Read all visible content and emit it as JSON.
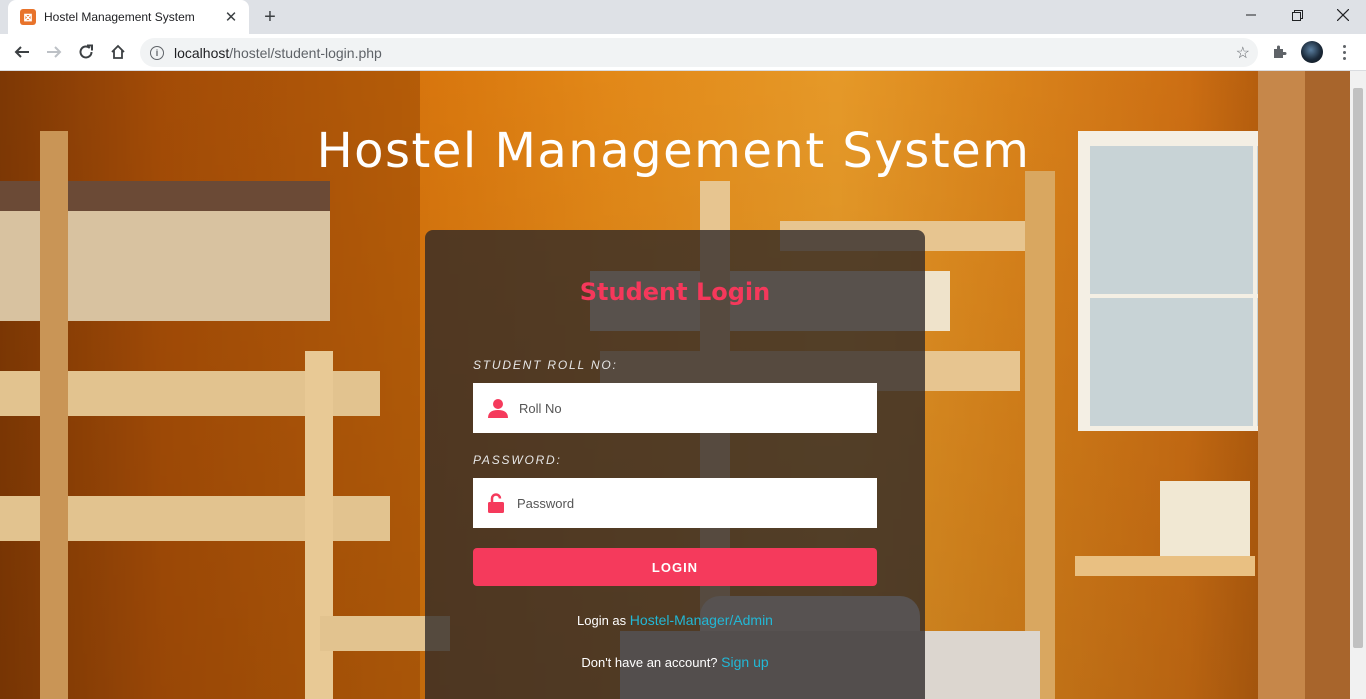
{
  "browser": {
    "tab_title": "Hostel Management System",
    "url_host": "localhost",
    "url_path": "/hostel/student-login.php"
  },
  "page": {
    "title": "Hostel Management System"
  },
  "login": {
    "heading": "Student Login",
    "roll_label": "STUDENT ROLL NO:",
    "roll_placeholder": "Roll No",
    "password_label": "PASSWORD:",
    "password_placeholder": "Password",
    "login_button": "LOGIN",
    "admin_prefix": "Login as",
    "admin_link": "Hostel-Manager/Admin",
    "signup_prefix": "Don't have an account?",
    "signup_link": "Sign up"
  },
  "colors": {
    "accent": "#f53a5c",
    "link": "#22b8d6"
  }
}
